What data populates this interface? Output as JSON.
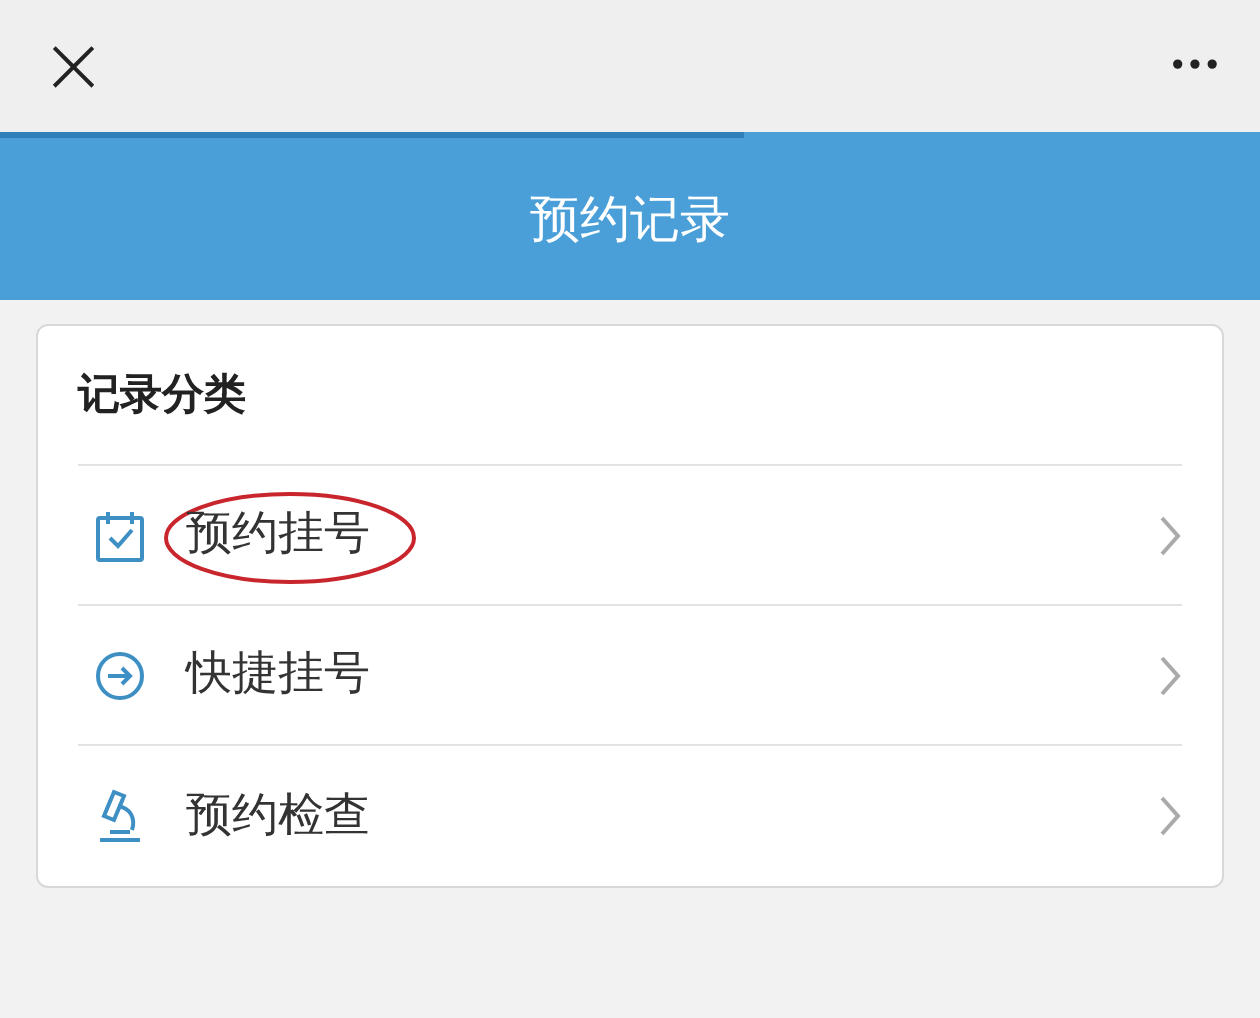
{
  "top_bar": {
    "close": "×",
    "more": "•••"
  },
  "loading": {
    "level": 0.59
  },
  "header": {
    "title": "预约记录"
  },
  "card": {
    "title": "记录分类",
    "items": [
      {
        "kind": "calendar",
        "label": "预约挂号",
        "circled": true
      },
      {
        "kind": "arrow",
        "label": "快捷挂号",
        "circled": false
      },
      {
        "kind": "microscope",
        "label": "预约检查",
        "circled": false
      }
    ]
  }
}
